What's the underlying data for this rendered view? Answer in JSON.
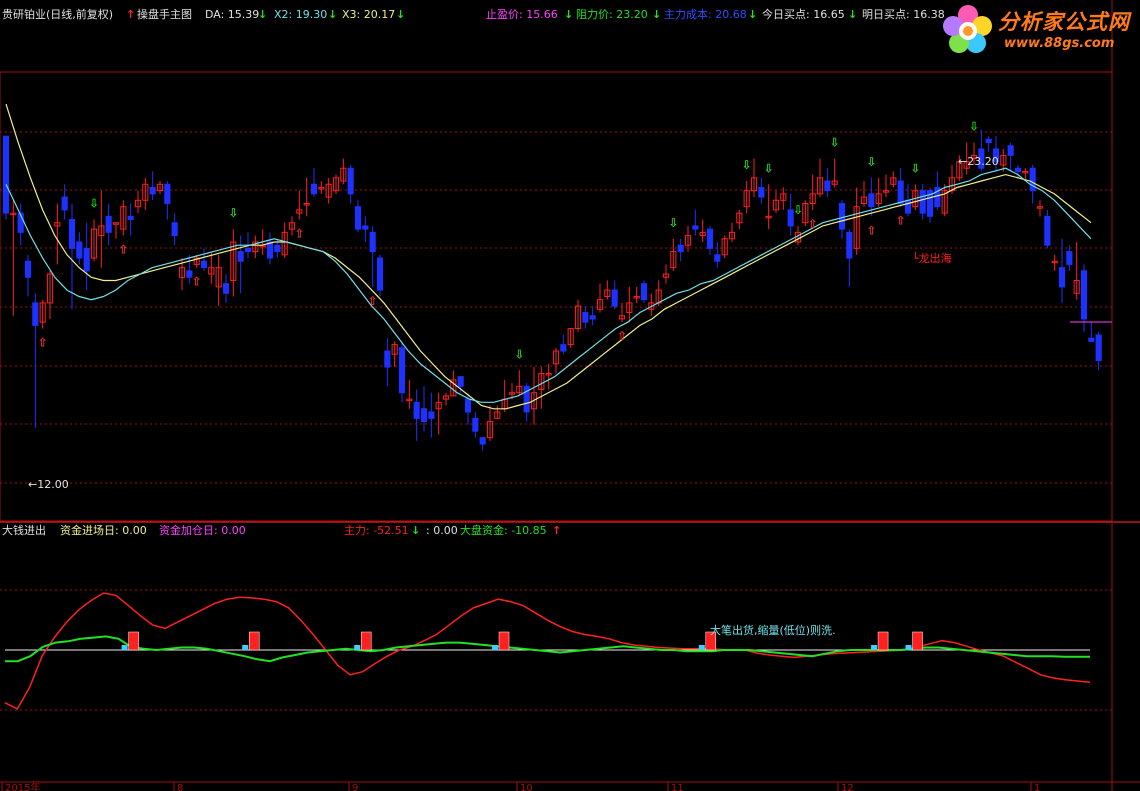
{
  "header": {
    "stock_label": "贵研铂业(日线,前复权)",
    "main_indicator": "操盘手主图",
    "da": "DA: 15.39",
    "x2": "X2: 19.30",
    "x3": "X3: 20.17",
    "stop_profit": "止盈价: 15.66",
    "resistance": "阻力价: 23.20",
    "main_cost": "主力成本: 20.68",
    "today_buy": "今日买点: 16.65",
    "tomorrow_buy": "明日买点: 16.38"
  },
  "sub_header": {
    "title": "大钱进出",
    "fund_entry": "资金进场日: 0.00",
    "fund_add": "资金加仓日: 0.00",
    "main_force": "主力: -52.51",
    "unnamed": ": 0.00",
    "market_fund": "大盘资金: -10.85"
  },
  "logo": {
    "cn": "分析家公式网",
    "url": "www.88gs.com"
  },
  "chart_data": [
    {
      "type": "candlestick",
      "price_range": [
        12.0,
        23.2
      ],
      "annotations": {
        "high_label": "23.20",
        "low_label": "12.00",
        "signal_text": "龙出海"
      },
      "tick_labels_x": [
        "2015年",
        "8",
        "9",
        "10",
        "11",
        "12",
        "1"
      ],
      "colors": {
        "up": "#ff2020",
        "down": "#1e32ff",
        "ma_fast": "#6fe0e8",
        "ma_slow": "#f0f08a",
        "grid": "#a01010"
      },
      "candles": [
        [
          23.0,
          20.6,
          23.0,
          20.4
        ],
        [
          20.6,
          20.6,
          21.0,
          17.4
        ],
        [
          20.6,
          20.0,
          20.9,
          19.6
        ],
        [
          19.1,
          18.6,
          19.3,
          18.0
        ],
        [
          17.8,
          17.1,
          18.1,
          13.9
        ],
        [
          17.2,
          17.8,
          17.9,
          17.0
        ],
        [
          17.8,
          18.7,
          18.8,
          17.3
        ],
        [
          20.2,
          20.3,
          20.9,
          19.0
        ],
        [
          21.1,
          20.7,
          21.5,
          20.4
        ],
        [
          20.4,
          19.5,
          20.9,
          17.6
        ],
        [
          19.7,
          19.2,
          20.0,
          19.0
        ],
        [
          19.5,
          18.8,
          20.3,
          18.2
        ],
        [
          19.2,
          20.1,
          20.4,
          19.1
        ],
        [
          19.9,
          20.2,
          21.3,
          18.9
        ],
        [
          20.5,
          20.0,
          20.9,
          19.6
        ],
        [
          20.3,
          20.3,
          20.3,
          19.8
        ],
        [
          20.1,
          20.8,
          21.0,
          19.9
        ],
        [
          20.5,
          20.4,
          20.9,
          19.9
        ],
        [
          20.8,
          21.0,
          21.3,
          20.6
        ],
        [
          21.0,
          21.5,
          21.7,
          20.7
        ],
        [
          21.4,
          21.2,
          21.9,
          21.0
        ],
        [
          21.3,
          21.5,
          21.6,
          21.2
        ],
        [
          21.5,
          20.9,
          21.6,
          20.4
        ],
        [
          20.3,
          19.9,
          20.6,
          19.6
        ],
        [
          18.6,
          18.9,
          19.2,
          18.2
        ],
        [
          18.8,
          18.6,
          19.3,
          18.4
        ],
        [
          19.0,
          19.2,
          19.3,
          18.9
        ],
        [
          19.1,
          18.9,
          19.5,
          18.8
        ],
        [
          18.7,
          18.9,
          19.4,
          18.4
        ],
        [
          18.3,
          18.9,
          19.3,
          17.7
        ],
        [
          18.4,
          18.1,
          18.7,
          17.8
        ],
        [
          18.5,
          19.7,
          20.1,
          18.0
        ],
        [
          19.4,
          19.1,
          19.9,
          18.1
        ],
        [
          19.5,
          19.4,
          20.0,
          19.2
        ],
        [
          19.4,
          19.7,
          19.9,
          19.2
        ],
        [
          19.6,
          19.6,
          20.1,
          19.3
        ],
        [
          19.7,
          19.2,
          20.0,
          19.0
        ],
        [
          19.6,
          19.4,
          19.8,
          19.2
        ],
        [
          19.3,
          20.0,
          20.3,
          19.2
        ],
        [
          20.1,
          20.3,
          20.5,
          19.9
        ],
        [
          20.6,
          20.7,
          21.3,
          20.4
        ],
        [
          20.9,
          20.9,
          21.7,
          20.5
        ],
        [
          21.5,
          21.2,
          22.0,
          21.1
        ],
        [
          21.4,
          21.4,
          21.6,
          21.2
        ],
        [
          21.1,
          21.5,
          21.7,
          20.9
        ],
        [
          21.3,
          21.7,
          21.8,
          21.2
        ],
        [
          21.6,
          22.0,
          22.3,
          21.5
        ],
        [
          22.0,
          21.2,
          22.1,
          20.9
        ],
        [
          20.8,
          20.1,
          21.0,
          20.0
        ],
        [
          20.2,
          20.1,
          20.5,
          19.7
        ],
        [
          20.0,
          19.4,
          20.2,
          18.3
        ],
        [
          19.2,
          18.2,
          19.3,
          18.0
        ],
        [
          16.3,
          15.8,
          16.7,
          15.2
        ],
        [
          16.2,
          16.5,
          16.6,
          15.8
        ],
        [
          16.4,
          15.0,
          16.6,
          14.7
        ],
        [
          14.8,
          14.8,
          15.4,
          14.5
        ],
        [
          14.7,
          14.2,
          15.1,
          13.5
        ],
        [
          14.5,
          14.1,
          15.2,
          13.8
        ],
        [
          14.4,
          14.2,
          15.0,
          13.6
        ],
        [
          14.5,
          14.7,
          15.0,
          13.7
        ],
        [
          14.8,
          14.9,
          15.0,
          14.6
        ],
        [
          14.9,
          15.4,
          15.7,
          14.9
        ],
        [
          15.5,
          15.2,
          15.5,
          15.0
        ],
        [
          14.8,
          14.4,
          15.0,
          14.0
        ],
        [
          14.2,
          13.8,
          14.4,
          13.6
        ],
        [
          13.6,
          13.4,
          13.6,
          13.2
        ],
        [
          13.6,
          14.1,
          14.6,
          13.5
        ],
        [
          14.2,
          14.4,
          14.6,
          14.2
        ],
        [
          14.5,
          14.8,
          15.4,
          14.4
        ],
        [
          15.0,
          15.0,
          15.3,
          14.8
        ],
        [
          15.0,
          15.2,
          15.7,
          14.9
        ],
        [
          15.2,
          14.4,
          15.3,
          14.1
        ],
        [
          14.5,
          15.0,
          15.8,
          14.0
        ],
        [
          15.1,
          15.6,
          15.8,
          14.5
        ],
        [
          15.6,
          15.6,
          15.9,
          15.1
        ],
        [
          15.9,
          16.3,
          16.4,
          15.6
        ],
        [
          16.5,
          16.3,
          16.8,
          16.2
        ],
        [
          16.5,
          17.0,
          17.0,
          16.4
        ],
        [
          17.0,
          17.7,
          17.9,
          16.9
        ],
        [
          17.5,
          17.2,
          17.7,
          17.0
        ],
        [
          17.4,
          17.3,
          17.7,
          17.1
        ],
        [
          17.6,
          17.9,
          18.4,
          17.5
        ],
        [
          18.0,
          18.2,
          18.5,
          17.9
        ],
        [
          18.2,
          17.7,
          18.5,
          17.6
        ],
        [
          17.3,
          17.4,
          17.8,
          17.2
        ],
        [
          17.5,
          17.8,
          18.3,
          17.2
        ],
        [
          18.0,
          18.0,
          18.3,
          17.8
        ],
        [
          18.4,
          17.9,
          18.5,
          17.8
        ],
        [
          17.6,
          17.8,
          18.1,
          17.4
        ],
        [
          17.8,
          18.2,
          18.5,
          17.7
        ],
        [
          18.6,
          18.7,
          19.0,
          18.4
        ],
        [
          18.9,
          19.4,
          19.8,
          18.8
        ],
        [
          19.6,
          19.4,
          19.8,
          19.1
        ],
        [
          19.6,
          19.9,
          20.2,
          19.4
        ],
        [
          20.2,
          20.1,
          20.7,
          19.9
        ],
        [
          19.9,
          20.0,
          20.4,
          19.7
        ],
        [
          20.1,
          19.5,
          20.2,
          19.3
        ],
        [
          19.3,
          19.1,
          19.7,
          18.9
        ],
        [
          19.3,
          19.8,
          19.9,
          19.2
        ],
        [
          19.8,
          20.0,
          20.3,
          19.7
        ],
        [
          20.3,
          20.6,
          20.7,
          20.1
        ],
        [
          20.8,
          21.3,
          21.6,
          20.6
        ],
        [
          21.3,
          21.7,
          22.3,
          21.1
        ],
        [
          21.4,
          21.1,
          21.7,
          20.9
        ],
        [
          20.5,
          20.5,
          21.5,
          20.1
        ],
        [
          20.7,
          21.0,
          21.3,
          20.6
        ],
        [
          21.0,
          21.2,
          21.4,
          20.7
        ],
        [
          20.7,
          20.2,
          21.2,
          19.9
        ],
        [
          19.7,
          20.0,
          20.2,
          19.6
        ],
        [
          20.3,
          20.9,
          21.0,
          20.2
        ],
        [
          20.9,
          21.2,
          21.8,
          20.7
        ],
        [
          21.2,
          21.7,
          22.3,
          21.1
        ],
        [
          21.6,
          21.3,
          22.0,
          21.1
        ],
        [
          21.5,
          21.6,
          22.3,
          21.4
        ],
        [
          20.9,
          20.1,
          21.0,
          19.8
        ],
        [
          20.0,
          19.2,
          20.1,
          18.3
        ],
        [
          19.5,
          20.8,
          21.4,
          19.3
        ],
        [
          20.9,
          21.1,
          21.6,
          20.8
        ],
        [
          21.2,
          20.8,
          21.7,
          20.5
        ],
        [
          20.9,
          21.2,
          21.7,
          20.8
        ],
        [
          21.3,
          21.3,
          21.8,
          21.1
        ],
        [
          21.5,
          21.7,
          21.9,
          21.4
        ],
        [
          21.6,
          20.9,
          22.0,
          20.8
        ],
        [
          21.0,
          20.6,
          21.5,
          20.5
        ],
        [
          20.8,
          21.3,
          21.5,
          20.7
        ],
        [
          21.3,
          20.6,
          21.5,
          20.4
        ],
        [
          21.3,
          20.5,
          21.4,
          20.3
        ],
        [
          21.4,
          20.8,
          21.9,
          20.7
        ],
        [
          20.6,
          21.3,
          21.5,
          20.5
        ],
        [
          21.3,
          21.7,
          22.1,
          21.2
        ],
        [
          21.7,
          22.2,
          22.4,
          21.6
        ],
        [
          22.0,
          22.2,
          22.8,
          21.8
        ],
        [
          22.3,
          22.4,
          22.8,
          22.1
        ],
        [
          22.6,
          22.0,
          23.2,
          21.9
        ],
        [
          22.9,
          22.8,
          23.0,
          22.5
        ],
        [
          22.6,
          22.2,
          23.0,
          21.9
        ],
        [
          22.1,
          22.4,
          22.6,
          21.9
        ],
        [
          22.7,
          22.4,
          22.8,
          21.9
        ],
        [
          22.0,
          21.9,
          22.1,
          21.7
        ],
        [
          21.9,
          21.9,
          22.0,
          21.6
        ],
        [
          22.0,
          21.3,
          22.1,
          20.9
        ],
        [
          20.8,
          20.8,
          21.0,
          20.5
        ],
        [
          20.5,
          19.6,
          20.7,
          19.5
        ],
        [
          19.1,
          19.1,
          19.3,
          18.8
        ],
        [
          18.9,
          18.3,
          19.8,
          17.8
        ],
        [
          19.4,
          19.0,
          19.6,
          18.8
        ],
        [
          18.1,
          18.5,
          19.7,
          17.9
        ],
        [
          18.8,
          17.3,
          19.0,
          16.9
        ],
        [
          16.7,
          16.6,
          17.2,
          16.6
        ],
        [
          16.8,
          16.0,
          16.9,
          15.7
        ]
      ],
      "ma_fast": [
        21.5,
        20.7,
        19.9,
        19.2,
        18.6,
        18.2,
        18.0,
        17.9,
        18.0,
        18.2,
        18.5,
        18.7,
        18.9,
        19.0,
        19.1,
        19.2,
        19.3,
        19.4,
        19.5,
        19.6,
        19.6,
        19.7,
        19.8,
        19.7,
        19.6,
        19.5,
        19.4,
        19.1,
        18.7,
        18.2,
        17.7,
        17.3,
        16.8,
        16.3,
        15.9,
        15.6,
        15.3,
        15.0,
        14.8,
        14.7,
        14.7,
        14.8,
        14.9,
        15.1,
        15.3,
        15.5,
        15.8,
        16.1,
        16.4,
        16.7,
        17.0,
        17.2,
        17.5,
        17.7,
        17.9,
        18.1,
        18.2,
        18.4,
        18.5,
        18.7,
        18.9,
        19.1,
        19.3,
        19.5,
        19.7,
        19.9,
        20.1,
        20.3,
        20.4,
        20.5,
        20.6,
        20.7,
        20.8,
        20.9,
        21.0,
        21.1,
        21.2,
        21.4,
        21.5,
        21.6,
        21.8,
        21.9,
        22.0,
        21.8,
        21.5,
        21.3,
        21.0,
        20.6,
        20.2,
        19.8
      ],
      "ma_slow": [
        24.0,
        22.8,
        21.7,
        20.7,
        19.9,
        19.3,
        18.9,
        18.6,
        18.5,
        18.5,
        18.6,
        18.7,
        18.8,
        18.9,
        19.0,
        19.1,
        19.2,
        19.3,
        19.4,
        19.5,
        19.6,
        19.6,
        19.7,
        19.7,
        19.6,
        19.5,
        19.4,
        19.2,
        18.9,
        18.6,
        18.2,
        17.8,
        17.3,
        16.8,
        16.3,
        15.9,
        15.5,
        15.2,
        14.9,
        14.6,
        14.5,
        14.5,
        14.6,
        14.7,
        14.9,
        15.1,
        15.3,
        15.6,
        15.9,
        16.2,
        16.5,
        16.8,
        17.1,
        17.3,
        17.6,
        17.8,
        18.0,
        18.2,
        18.4,
        18.6,
        18.8,
        19.0,
        19.2,
        19.4,
        19.6,
        19.8,
        20.0,
        20.2,
        20.3,
        20.4,
        20.5,
        20.6,
        20.7,
        20.8,
        20.9,
        21.0,
        21.1,
        21.2,
        21.4,
        21.5,
        21.6,
        21.7,
        21.8,
        21.7,
        21.6,
        21.4,
        21.2,
        20.9,
        20.6,
        20.3
      ]
    },
    {
      "type": "line",
      "title": "大钱进出",
      "series": [
        {
          "name": "主力",
          "color": "#ff2020",
          "values": [
            -85,
            -95,
            -60,
            -10,
            20,
            45,
            65,
            80,
            92,
            88,
            72,
            55,
            40,
            35,
            45,
            55,
            65,
            75,
            82,
            85,
            84,
            82,
            78,
            68,
            48,
            25,
            0,
            -25,
            -40,
            -35,
            -22,
            -10,
            0,
            6,
            15,
            25,
            40,
            55,
            68,
            75,
            82,
            78,
            72,
            60,
            48,
            38,
            30,
            25,
            22,
            18,
            12,
            8,
            6,
            4,
            3,
            2,
            2,
            2,
            1,
            0,
            0,
            -5,
            -8,
            -10,
            -12,
            -10,
            -8,
            -6,
            -5,
            -4,
            -3,
            -2,
            -1,
            0,
            5,
            10,
            15,
            12,
            6,
            0,
            -5,
            -10,
            -20,
            -30,
            -40,
            -45,
            -48,
            -50,
            -52
          ]
        },
        {
          "name": "大盘资金",
          "color": "#22e022",
          "values": [
            -18,
            -18,
            -10,
            5,
            12,
            14,
            18,
            20,
            22,
            18,
            5,
            2,
            0,
            2,
            4,
            4,
            2,
            -2,
            -6,
            -10,
            -15,
            -18,
            -12,
            -8,
            -4,
            -2,
            0,
            2,
            0,
            -2,
            0,
            4,
            6,
            8,
            10,
            12,
            12,
            10,
            8,
            6,
            4,
            2,
            0,
            -2,
            -4,
            -2,
            0,
            2,
            4,
            6,
            4,
            2,
            0,
            0,
            -2,
            -2,
            -2,
            0,
            0,
            0,
            -2,
            -4,
            -6,
            -8,
            -10,
            -6,
            -2,
            0,
            0,
            0,
            0,
            0,
            2,
            4,
            4,
            2,
            0,
            -2,
            -4,
            -6,
            -8,
            -10,
            -10,
            -10,
            -11,
            -11,
            -10.85
          ]
        }
      ],
      "zero_bars": [
        14,
        28,
        41,
        57,
        81,
        101,
        105
      ],
      "annotation": "大笔出货,缩量(低位)则洗."
    }
  ]
}
